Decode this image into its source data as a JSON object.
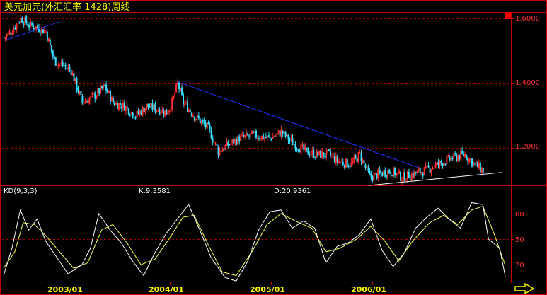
{
  "title": "美元加元(外汇汇率 1428)周线",
  "kd": {
    "label": "KD(9,3,3)",
    "k_readout": "K:9.3581",
    "d_readout": "D:20.9361"
  },
  "colors": {
    "background": "#000000",
    "frame": "#cc0000",
    "grid": "#aa0000",
    "up": "#ff2a2a",
    "down": "#33e0ff",
    "trendline": "#2233ff",
    "support_line": "#ffffff",
    "k_line": "#ffffff",
    "d_line": "#ffff55",
    "axis_text": "#ff3030",
    "date_text": "#ffff00"
  },
  "icons": {
    "scroll": "right-arrow-icon",
    "marker": "red-square-icon"
  },
  "chart_data": [
    {
      "type": "candlestick",
      "title": "美元加元(外汇汇率 1428)周线",
      "ylim": [
        1.085,
        1.618
      ],
      "yticks": [
        1.2,
        1.4,
        1.6
      ],
      "ytick_labels": [
        "1.2000",
        "1.4000",
        "1.6000"
      ],
      "x_labels": [
        "2003/01",
        "2004/01",
        "2005/01",
        "2006/01"
      ],
      "grid": true,
      "close_anchors": [
        [
          0,
          1.54
        ],
        [
          5,
          1.56
        ],
        [
          12,
          1.6
        ],
        [
          18,
          1.58
        ],
        [
          25,
          1.57
        ],
        [
          30,
          1.56
        ],
        [
          36,
          1.47
        ],
        [
          48,
          1.44
        ],
        [
          56,
          1.34
        ],
        [
          64,
          1.36
        ],
        [
          72,
          1.39
        ],
        [
          78,
          1.34
        ],
        [
          86,
          1.33
        ],
        [
          94,
          1.3
        ],
        [
          102,
          1.33
        ],
        [
          110,
          1.32
        ],
        [
          116,
          1.31
        ],
        [
          120,
          1.34
        ],
        [
          124,
          1.4
        ],
        [
          128,
          1.34
        ],
        [
          136,
          1.3
        ],
        [
          146,
          1.26
        ],
        [
          153,
          1.19
        ],
        [
          160,
          1.21
        ],
        [
          168,
          1.23
        ],
        [
          178,
          1.24
        ],
        [
          190,
          1.23
        ],
        [
          198,
          1.25
        ],
        [
          205,
          1.22
        ],
        [
          215,
          1.19
        ],
        [
          223,
          1.18
        ],
        [
          232,
          1.18
        ],
        [
          238,
          1.16
        ],
        [
          248,
          1.15
        ],
        [
          254,
          1.18
        ],
        [
          261,
          1.11
        ],
        [
          268,
          1.12
        ],
        [
          276,
          1.13
        ],
        [
          284,
          1.11
        ],
        [
          292,
          1.12
        ],
        [
          300,
          1.13
        ],
        [
          310,
          1.15
        ],
        [
          320,
          1.17
        ],
        [
          329,
          1.18
        ],
        [
          336,
          1.15
        ],
        [
          342,
          1.13
        ]
      ],
      "trendlines": [
        {
          "points": [
            [
              1,
              1.533
            ],
            [
              40,
              1.59
            ]
          ]
        },
        {
          "points": [
            [
              124,
              1.405
            ],
            [
              296,
              1.14
            ]
          ]
        },
        {
          "points": [
            [
              261,
              1.085
            ],
            [
              356,
              1.125
            ]
          ]
        }
      ]
    },
    {
      "type": "line",
      "title": "KD(9,3,3)",
      "ylim": [
        5,
        95
      ],
      "yticks": [
        20,
        50,
        80
      ],
      "ytick_labels": [
        "20",
        "50",
        "80"
      ],
      "series": [
        {
          "name": "K",
          "value": 9.3581
        },
        {
          "name": "D",
          "value": 20.9361
        }
      ],
      "k_anchors": [
        [
          0,
          10
        ],
        [
          6,
          40
        ],
        [
          12,
          82
        ],
        [
          18,
          60
        ],
        [
          24,
          72
        ],
        [
          30,
          48
        ],
        [
          38,
          30
        ],
        [
          46,
          12
        ],
        [
          56,
          22
        ],
        [
          62,
          40
        ],
        [
          68,
          78
        ],
        [
          76,
          60
        ],
        [
          84,
          46
        ],
        [
          92,
          26
        ],
        [
          100,
          10
        ],
        [
          108,
          35
        ],
        [
          116,
          56
        ],
        [
          124,
          72
        ],
        [
          132,
          88
        ],
        [
          140,
          60
        ],
        [
          148,
          30
        ],
        [
          158,
          8
        ],
        [
          166,
          4
        ],
        [
          174,
          25
        ],
        [
          182,
          60
        ],
        [
          190,
          80
        ],
        [
          198,
          82
        ],
        [
          206,
          62
        ],
        [
          214,
          70
        ],
        [
          222,
          62
        ],
        [
          230,
          24
        ],
        [
          238,
          42
        ],
        [
          246,
          46
        ],
        [
          254,
          55
        ],
        [
          262,
          72
        ],
        [
          270,
          38
        ],
        [
          278,
          20
        ],
        [
          286,
          35
        ],
        [
          294,
          62
        ],
        [
          302,
          74
        ],
        [
          310,
          84
        ],
        [
          318,
          72
        ],
        [
          326,
          62
        ],
        [
          334,
          90
        ],
        [
          342,
          88
        ],
        [
          346,
          50
        ],
        [
          354,
          40
        ],
        [
          358,
          9
        ]
      ],
      "d_anchors": [
        [
          0,
          18
        ],
        [
          8,
          36
        ],
        [
          14,
          68
        ],
        [
          22,
          66
        ],
        [
          30,
          54
        ],
        [
          40,
          36
        ],
        [
          50,
          18
        ],
        [
          60,
          24
        ],
        [
          70,
          60
        ],
        [
          78,
          66
        ],
        [
          88,
          46
        ],
        [
          98,
          22
        ],
        [
          108,
          28
        ],
        [
          118,
          50
        ],
        [
          128,
          74
        ],
        [
          136,
          76
        ],
        [
          146,
          44
        ],
        [
          156,
          14
        ],
        [
          166,
          10
        ],
        [
          178,
          38
        ],
        [
          188,
          66
        ],
        [
          198,
          78
        ],
        [
          208,
          70
        ],
        [
          220,
          62
        ],
        [
          230,
          36
        ],
        [
          240,
          40
        ],
        [
          252,
          50
        ],
        [
          262,
          64
        ],
        [
          272,
          48
        ],
        [
          282,
          26
        ],
        [
          292,
          48
        ],
        [
          304,
          68
        ],
        [
          314,
          76
        ],
        [
          324,
          66
        ],
        [
          334,
          82
        ],
        [
          342,
          86
        ],
        [
          350,
          56
        ],
        [
          358,
          21
        ]
      ]
    }
  ]
}
